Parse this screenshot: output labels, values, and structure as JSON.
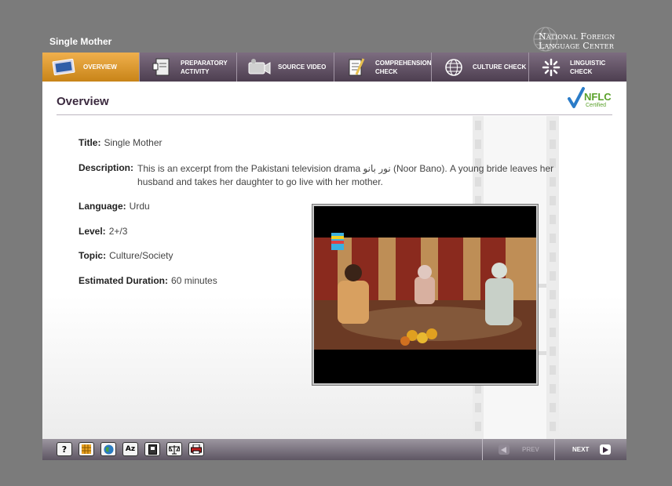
{
  "app": {
    "title": "Single Mother"
  },
  "logo": {
    "line1": "National Foreign",
    "line2": "Language Center"
  },
  "nav": {
    "items": [
      {
        "label": "Overview",
        "icon": "monitor-icon",
        "active": true
      },
      {
        "label": "Preparatory Activity",
        "icon": "notepad-icon",
        "active": false
      },
      {
        "label": "Source Video",
        "icon": "video-camera-icon",
        "active": false
      },
      {
        "label": "Comprehension Check",
        "icon": "pencil-paper-icon",
        "active": false
      },
      {
        "label": "Culture Check",
        "icon": "globe-icon",
        "active": false
      },
      {
        "label": "Linguistic Check",
        "icon": "sparkle-icon",
        "active": false
      }
    ]
  },
  "content": {
    "heading": "Overview",
    "badge": {
      "text": "NFLC",
      "subtext": "Certified"
    },
    "title": {
      "label": "Title:",
      "value": "Single Mother"
    },
    "description": {
      "label": "Description:",
      "value": "This is an excerpt from the Pakistani television drama نور بانو (Noor Bano). A young bride leaves her husband and takes her daughter to go live with her mother."
    },
    "language": {
      "label": "Language:",
      "value": "Urdu"
    },
    "level": {
      "label": "Level:",
      "value": "2+/3"
    },
    "topic": {
      "label": "Topic:",
      "value": "Culture/Society"
    },
    "duration": {
      "label": "Estimated Duration:",
      "value": "60 minutes"
    }
  },
  "footer": {
    "tools": [
      {
        "icon": "help-icon",
        "text": "?"
      },
      {
        "icon": "grid-icon",
        "text": ""
      },
      {
        "icon": "globe-icon",
        "text": ""
      },
      {
        "icon": "dictionary-icon",
        "text": "Az"
      },
      {
        "icon": "book-icon",
        "text": ""
      },
      {
        "icon": "scales-icon",
        "text": ""
      },
      {
        "icon": "print-icon",
        "text": ""
      }
    ],
    "prev_label": "PREV",
    "next_label": "NEXT"
  },
  "colors": {
    "nav": "#5e4f62",
    "active_tab": "#e0a035",
    "heading": "#3b2a3f",
    "badge": "#5aa12a"
  }
}
